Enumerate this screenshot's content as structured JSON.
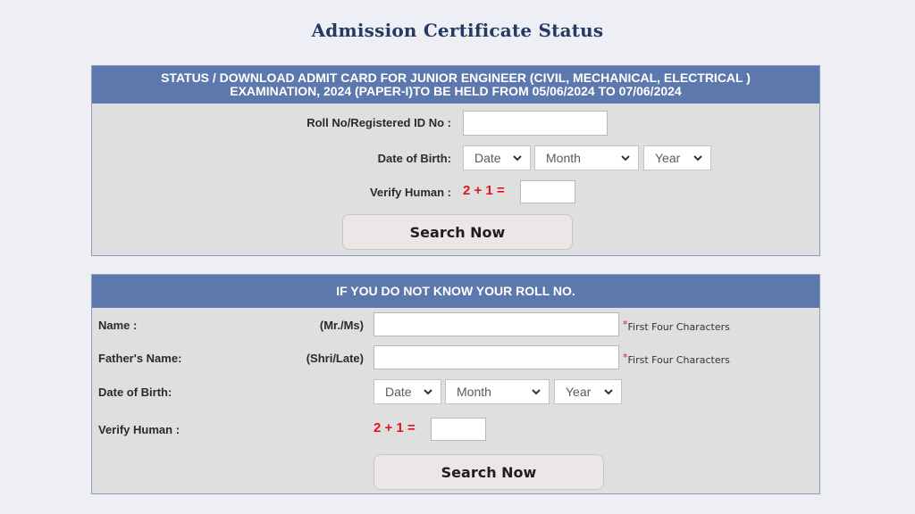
{
  "page": {
    "title": "Admission Certificate Status"
  },
  "section1": {
    "header_line1": "STATUS / DOWNLOAD ADMIT CARD FOR JUNIOR ENGINEER (CIVIL, MECHANICAL, ELECTRICAL )",
    "header_line2": "EXAMINATION, 2024 (PAPER-I)TO BE HELD FROM 05/06/2024 TO 07/06/2024",
    "roll_label": "Roll No/Registered ID No :",
    "roll_value": "",
    "dob_label": "Date of Birth:",
    "dob": {
      "date": "Date",
      "month": "Month",
      "year": "Year"
    },
    "verify_label": "Verify Human :",
    "captcha": "2 + 1 =",
    "captcha_value": "",
    "search_button": "Search Now"
  },
  "section2": {
    "header": "IF YOU DO NOT KNOW YOUR ROLL NO.",
    "name_label": "Name :",
    "name_prefix": "(Mr./Ms)",
    "name_value": "",
    "father_label": "Father's Name:",
    "father_prefix": "(Shri/Late)",
    "father_value": "",
    "required_mark": "*",
    "hint": "First Four Characters",
    "dob_label": "Date of Birth:",
    "dob": {
      "date": "Date",
      "month": "Month",
      "year": "Year"
    },
    "verify_label": "Verify Human :",
    "captcha": "2 + 1 =",
    "captcha_value": "",
    "search_button": "Search Now"
  },
  "colors": {
    "header_bg": "#5d78ad",
    "title": "#243a63",
    "captcha": "#e0141e",
    "panel_bg": "#dfdfe0"
  }
}
